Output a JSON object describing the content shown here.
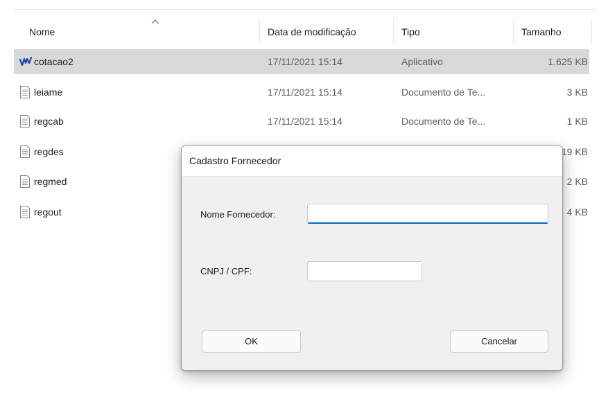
{
  "columns": {
    "name": "Nome",
    "date": "Data de modificação",
    "type": "Tipo",
    "size": "Tamanho"
  },
  "files": [
    {
      "name": "cotacao2",
      "date": "17/11/2021 15:14",
      "type": "Aplicativo",
      "size": "1.625 KB",
      "icon": "app-icon",
      "selected": true
    },
    {
      "name": "leiame",
      "date": "17/11/2021 15:14",
      "type": "Documento de Te...",
      "size": "3 KB",
      "icon": "text-file-icon"
    },
    {
      "name": "regcab",
      "date": "17/11/2021 15:14",
      "type": "Documento de Te...",
      "size": "1 KB",
      "icon": "text-file-icon"
    },
    {
      "name": "regdes",
      "size": "19 KB",
      "icon": "text-file-icon"
    },
    {
      "name": "regmed",
      "size": "2 KB",
      "icon": "text-file-icon"
    },
    {
      "name": "regout",
      "size": "4 KB",
      "icon": "text-file-icon"
    }
  ],
  "dialog": {
    "title": "Cadastro Fornecedor",
    "name_label": "Nome Fornecedor:",
    "name_value": "",
    "doc_label": "CNPJ / CPF:",
    "doc_value": "",
    "ok_label": "OK",
    "cancel_label": "Cancelar"
  },
  "colors": {
    "selection": "#d9d9d9",
    "focus_accent": "#0067c0",
    "app_icon_blue": "#1f3fae"
  }
}
